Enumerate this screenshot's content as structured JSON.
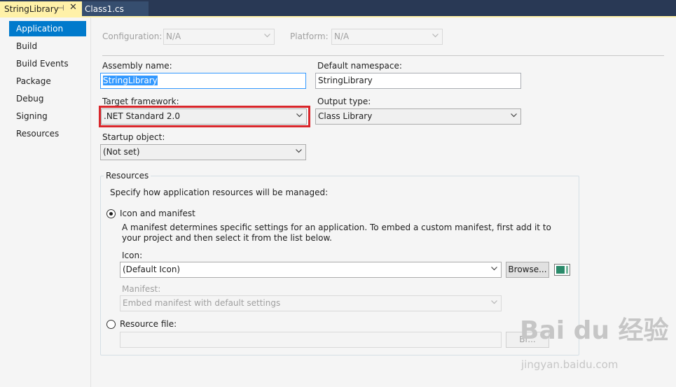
{
  "tabs": {
    "active": "StringLibrary",
    "active_pin": "⊣",
    "active_close": "✕",
    "inactive": "Class1.cs"
  },
  "nav": {
    "items": [
      "Application",
      "Build",
      "Build Events",
      "Package",
      "Debug",
      "Signing",
      "Resources"
    ]
  },
  "config": {
    "configuration_label": "Configuration:",
    "configuration_value": "N/A",
    "platform_label": "Platform:",
    "platform_value": "N/A"
  },
  "app": {
    "assembly_name_label": "Assembly name:",
    "assembly_name_value": "StringLibrary",
    "default_namespace_label": "Default namespace:",
    "default_namespace_value": "StringLibrary",
    "target_framework_label": "Target framework:",
    "target_framework_value": ".NET Standard 2.0",
    "output_type_label": "Output type:",
    "output_type_value": "Class Library",
    "startup_object_label": "Startup object:",
    "startup_object_value": "(Not set)"
  },
  "resources": {
    "group_title": "Resources",
    "description": "Specify how application resources will be managed:",
    "icon_manifest_label": "Icon and manifest",
    "manifest_help_line1": "A manifest determines specific settings for an application. To embed a custom manifest, first add it to",
    "manifest_help_line2": "your project and then select it from the list below.",
    "icon_label": "Icon:",
    "icon_value": "(Default Icon)",
    "browse_label": "Browse...",
    "manifest_label": "Manifest:",
    "manifest_value": "Embed manifest with default settings",
    "resource_file_label": "Resource file:",
    "resource_file_value": "",
    "browse2_label": "Br..."
  },
  "watermark": {
    "text": "Bai du 经验",
    "sub": "jingyan.baidu.com"
  },
  "colors": {
    "accent": "#007acc",
    "tab_active": "#fff1a8",
    "highlight": "#d9262b"
  }
}
